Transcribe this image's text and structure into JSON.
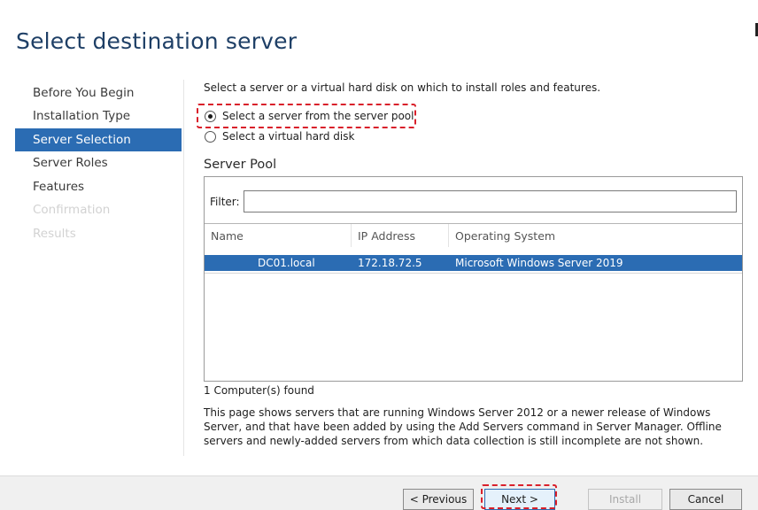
{
  "wizard": {
    "title": "Select destination server"
  },
  "nav": {
    "items": [
      {
        "label": "Before You Begin",
        "state": "normal"
      },
      {
        "label": "Installation Type",
        "state": "normal"
      },
      {
        "label": "Server Selection",
        "state": "active"
      },
      {
        "label": "Server Roles",
        "state": "normal"
      },
      {
        "label": "Features",
        "state": "normal"
      },
      {
        "label": "Confirmation",
        "state": "disabled"
      },
      {
        "label": "Results",
        "state": "disabled"
      }
    ]
  },
  "content": {
    "intro": "Select a server or a virtual hard disk on which to install roles and features.",
    "options": [
      {
        "label": "Select a server from the server pool",
        "checked": true
      },
      {
        "label": "Select a virtual hard disk",
        "checked": false
      }
    ],
    "pool_heading": "Server Pool",
    "filter_label": "Filter:",
    "filter_value": "",
    "columns": [
      "Name",
      "IP Address",
      "Operating System"
    ],
    "rows": [
      {
        "name": "DC01.local",
        "ip": "172.18.72.5",
        "os": "Microsoft Windows Server 2019",
        "selected": true
      }
    ],
    "count_text": "1 Computer(s) found",
    "description": "This page shows servers that are running Windows Server 2012 or a newer release of Windows Server, and that have been added by using the Add Servers command in Server Manager. Offline servers and newly-added servers from which data collection is still incomplete are not shown."
  },
  "buttons": {
    "previous": "< Previous",
    "next": "Next >",
    "install": "Install",
    "cancel": "Cancel"
  },
  "colors": {
    "accent": "#2b6cb3",
    "highlight": "#d9202b"
  }
}
